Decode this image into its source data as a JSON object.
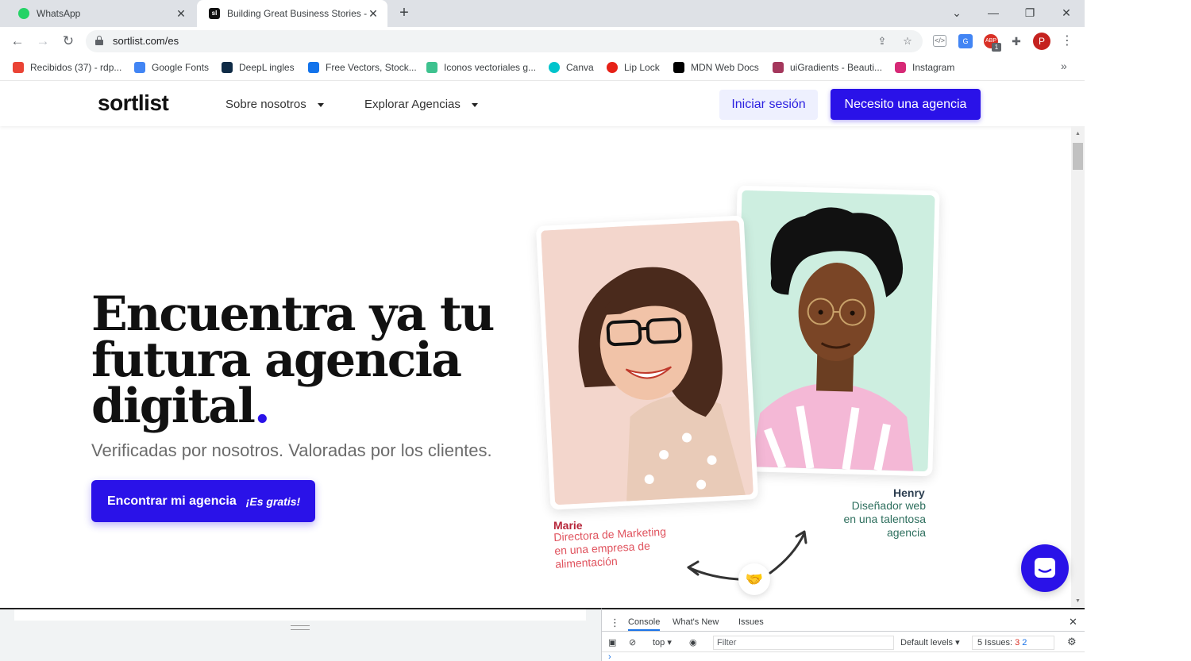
{
  "browser": {
    "tabs": [
      {
        "title": "WhatsApp",
        "favicon": "whatsapp-icon"
      },
      {
        "title": "Building Great Business Stories -",
        "favicon": "sortlist-icon"
      }
    ],
    "url": "sortlist.com/es",
    "bookmarks": [
      {
        "label": "Recibidos (37) - rdp...",
        "color": "#ea4335"
      },
      {
        "label": "Google Fonts",
        "color": "#4285f4"
      },
      {
        "label": "DeepL ingles",
        "color": "#0f2b46"
      },
      {
        "label": "Free Vectors, Stock...",
        "color": "#1273eb"
      },
      {
        "label": "Iconos vectoriales g...",
        "color": "#3ec28f"
      },
      {
        "label": "Canva",
        "color": "#00c4cc"
      },
      {
        "label": "Lip Lock",
        "color": "#e62117"
      },
      {
        "label": "MDN Web Docs",
        "color": "#000000"
      },
      {
        "label": "uiGradients - Beauti...",
        "color": "#a4375c"
      },
      {
        "label": "Instagram",
        "color": "#d62976"
      }
    ],
    "more_bookmarks": "»",
    "extension_badge": "1",
    "profile_initial": "P"
  },
  "site": {
    "logo": "sortlist",
    "nav": [
      {
        "label": "Sobre nosotros"
      },
      {
        "label": "Explorar Agencias"
      }
    ],
    "login_label": "Iniciar sesión",
    "need_agency_label": "Necesito una agencia",
    "brand_color": "#2a12e8"
  },
  "hero": {
    "title_line1": "Encuentra ya tu",
    "title_line2": "futura agencia",
    "title_line3": "digital",
    "title_dot": ".",
    "subtitle": "Verificadas por nosotros. Valoradas por los clientes.",
    "cta_main": "Encontrar mi agencia",
    "cta_free": "¡Es gratis!"
  },
  "people": {
    "marie": {
      "name": "Marie",
      "role_lines": [
        "Directora de Marketing",
        "en una empresa de",
        "alimentación"
      ]
    },
    "henry": {
      "name": "Henry",
      "role_lines": [
        "Diseñador web",
        "en una talentosa",
        "agencia"
      ]
    }
  },
  "devtools": {
    "tabs": [
      "Console",
      "What's New",
      "Issues"
    ],
    "context": "top",
    "filter_placeholder": "Filter",
    "levels": "Default levels",
    "issues_label": "5 Issues:",
    "errors": "3",
    "messages": "2"
  }
}
